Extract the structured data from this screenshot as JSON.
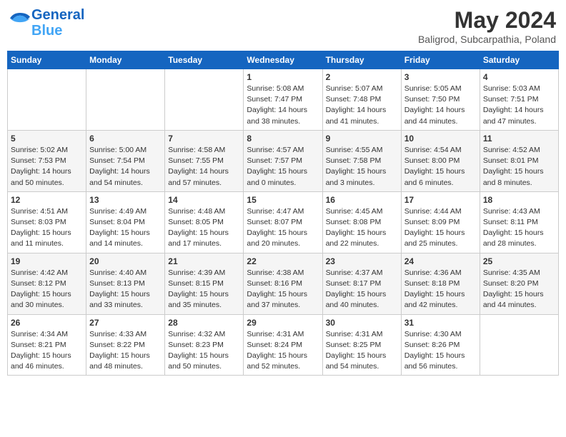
{
  "header": {
    "logo_general": "General",
    "logo_blue": "Blue",
    "month": "May 2024",
    "location": "Baligrod, Subcarpathia, Poland"
  },
  "weekdays": [
    "Sunday",
    "Monday",
    "Tuesday",
    "Wednesday",
    "Thursday",
    "Friday",
    "Saturday"
  ],
  "weeks": [
    [
      {
        "day": "",
        "info": ""
      },
      {
        "day": "",
        "info": ""
      },
      {
        "day": "",
        "info": ""
      },
      {
        "day": "1",
        "info": "Sunrise: 5:08 AM\nSunset: 7:47 PM\nDaylight: 14 hours\nand 38 minutes."
      },
      {
        "day": "2",
        "info": "Sunrise: 5:07 AM\nSunset: 7:48 PM\nDaylight: 14 hours\nand 41 minutes."
      },
      {
        "day": "3",
        "info": "Sunrise: 5:05 AM\nSunset: 7:50 PM\nDaylight: 14 hours\nand 44 minutes."
      },
      {
        "day": "4",
        "info": "Sunrise: 5:03 AM\nSunset: 7:51 PM\nDaylight: 14 hours\nand 47 minutes."
      }
    ],
    [
      {
        "day": "5",
        "info": "Sunrise: 5:02 AM\nSunset: 7:53 PM\nDaylight: 14 hours\nand 50 minutes."
      },
      {
        "day": "6",
        "info": "Sunrise: 5:00 AM\nSunset: 7:54 PM\nDaylight: 14 hours\nand 54 minutes."
      },
      {
        "day": "7",
        "info": "Sunrise: 4:58 AM\nSunset: 7:55 PM\nDaylight: 14 hours\nand 57 minutes."
      },
      {
        "day": "8",
        "info": "Sunrise: 4:57 AM\nSunset: 7:57 PM\nDaylight: 15 hours\nand 0 minutes."
      },
      {
        "day": "9",
        "info": "Sunrise: 4:55 AM\nSunset: 7:58 PM\nDaylight: 15 hours\nand 3 minutes."
      },
      {
        "day": "10",
        "info": "Sunrise: 4:54 AM\nSunset: 8:00 PM\nDaylight: 15 hours\nand 6 minutes."
      },
      {
        "day": "11",
        "info": "Sunrise: 4:52 AM\nSunset: 8:01 PM\nDaylight: 15 hours\nand 8 minutes."
      }
    ],
    [
      {
        "day": "12",
        "info": "Sunrise: 4:51 AM\nSunset: 8:03 PM\nDaylight: 15 hours\nand 11 minutes."
      },
      {
        "day": "13",
        "info": "Sunrise: 4:49 AM\nSunset: 8:04 PM\nDaylight: 15 hours\nand 14 minutes."
      },
      {
        "day": "14",
        "info": "Sunrise: 4:48 AM\nSunset: 8:05 PM\nDaylight: 15 hours\nand 17 minutes."
      },
      {
        "day": "15",
        "info": "Sunrise: 4:47 AM\nSunset: 8:07 PM\nDaylight: 15 hours\nand 20 minutes."
      },
      {
        "day": "16",
        "info": "Sunrise: 4:45 AM\nSunset: 8:08 PM\nDaylight: 15 hours\nand 22 minutes."
      },
      {
        "day": "17",
        "info": "Sunrise: 4:44 AM\nSunset: 8:09 PM\nDaylight: 15 hours\nand 25 minutes."
      },
      {
        "day": "18",
        "info": "Sunrise: 4:43 AM\nSunset: 8:11 PM\nDaylight: 15 hours\nand 28 minutes."
      }
    ],
    [
      {
        "day": "19",
        "info": "Sunrise: 4:42 AM\nSunset: 8:12 PM\nDaylight: 15 hours\nand 30 minutes."
      },
      {
        "day": "20",
        "info": "Sunrise: 4:40 AM\nSunset: 8:13 PM\nDaylight: 15 hours\nand 33 minutes."
      },
      {
        "day": "21",
        "info": "Sunrise: 4:39 AM\nSunset: 8:15 PM\nDaylight: 15 hours\nand 35 minutes."
      },
      {
        "day": "22",
        "info": "Sunrise: 4:38 AM\nSunset: 8:16 PM\nDaylight: 15 hours\nand 37 minutes."
      },
      {
        "day": "23",
        "info": "Sunrise: 4:37 AM\nSunset: 8:17 PM\nDaylight: 15 hours\nand 40 minutes."
      },
      {
        "day": "24",
        "info": "Sunrise: 4:36 AM\nSunset: 8:18 PM\nDaylight: 15 hours\nand 42 minutes."
      },
      {
        "day": "25",
        "info": "Sunrise: 4:35 AM\nSunset: 8:20 PM\nDaylight: 15 hours\nand 44 minutes."
      }
    ],
    [
      {
        "day": "26",
        "info": "Sunrise: 4:34 AM\nSunset: 8:21 PM\nDaylight: 15 hours\nand 46 minutes."
      },
      {
        "day": "27",
        "info": "Sunrise: 4:33 AM\nSunset: 8:22 PM\nDaylight: 15 hours\nand 48 minutes."
      },
      {
        "day": "28",
        "info": "Sunrise: 4:32 AM\nSunset: 8:23 PM\nDaylight: 15 hours\nand 50 minutes."
      },
      {
        "day": "29",
        "info": "Sunrise: 4:31 AM\nSunset: 8:24 PM\nDaylight: 15 hours\nand 52 minutes."
      },
      {
        "day": "30",
        "info": "Sunrise: 4:31 AM\nSunset: 8:25 PM\nDaylight: 15 hours\nand 54 minutes."
      },
      {
        "day": "31",
        "info": "Sunrise: 4:30 AM\nSunset: 8:26 PM\nDaylight: 15 hours\nand 56 minutes."
      },
      {
        "day": "",
        "info": ""
      }
    ]
  ]
}
